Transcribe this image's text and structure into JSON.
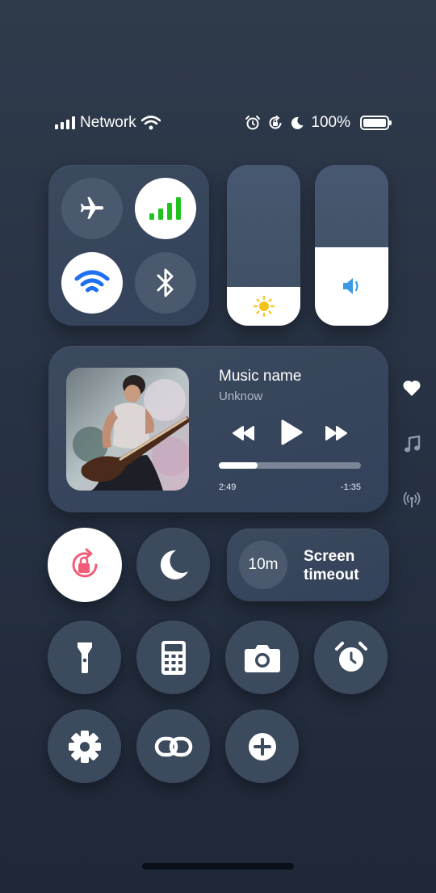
{
  "status_bar": {
    "network_label": "Network",
    "battery_text": "100%",
    "icons": [
      "cellular-signal-icon",
      "wifi-icon",
      "alarm-icon",
      "rotation-lock-icon",
      "moon-icon",
      "battery-icon"
    ]
  },
  "connectivity": {
    "airplane": {
      "icon": "airplane-icon",
      "active": false
    },
    "cellular": {
      "icon": "cellular-data-icon",
      "active": true,
      "color": "#1ec31e"
    },
    "wifi": {
      "icon": "wifi-icon",
      "active": true,
      "color": "#1f6ff2"
    },
    "bluetooth": {
      "icon": "bluetooth-icon",
      "active": false
    }
  },
  "sliders": {
    "brightness": {
      "icon": "sun-icon",
      "level": 0.24,
      "color": "#f6c21a"
    },
    "volume": {
      "icon": "speaker-icon",
      "level": 0.49,
      "color": "#3a9be4"
    }
  },
  "music": {
    "title": "Music name",
    "artist": "Unknow",
    "elapsed": "2:49",
    "remaining": "-1:35",
    "progress": 0.27,
    "icons": [
      "album-art",
      "rewind-icon",
      "play-icon",
      "fast-forward-icon"
    ]
  },
  "side_icons": [
    "heart-icon",
    "music-note-icon",
    "broadcast-icon"
  ],
  "toggles": {
    "rotation_lock": {
      "icon": "rotation-lock-icon",
      "active": true,
      "color": "#f25d78"
    },
    "do_not_disturb": {
      "icon": "moon-icon",
      "active": false
    }
  },
  "screen_timeout": {
    "value": "10m",
    "label_line1": "Screen",
    "label_line2": "timeout"
  },
  "shortcuts": [
    "flashlight-icon",
    "calculator-icon",
    "camera-icon",
    "alarm-clock-icon",
    "settings-icon",
    "link-icon",
    "add-icon"
  ],
  "colors": {
    "accent_green": "#1ec31e",
    "accent_blue": "#1f6ff2",
    "accent_pink": "#f25d78"
  }
}
